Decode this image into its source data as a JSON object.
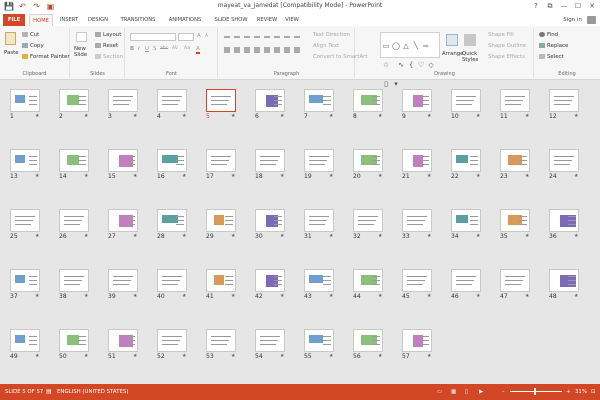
{
  "window": {
    "title": "mayeat_va_jamedat [Compatibility Mode] - PowerPoint",
    "controls": [
      "?",
      "⧉",
      "—",
      "☐",
      "✕"
    ]
  },
  "qat": [
    "💾",
    "↶",
    "↷",
    "▣"
  ],
  "tabs": [
    "FILE",
    "HOME",
    "INSERT",
    "DESIGN",
    "TRANSITIONS",
    "ANIMATIONS",
    "SLIDE SHOW",
    "REVIEW",
    "VIEW"
  ],
  "signin": "Sign in",
  "ribbon": {
    "clipboard": {
      "label": "Clipboard",
      "paste": "Paste",
      "cut": "Cut",
      "copy": "Copy",
      "format_painter": "Format Painter"
    },
    "slides": {
      "label": "Slides",
      "new_slide": "New Slide",
      "layout": "Layout",
      "reset": "Reset",
      "section": "Section"
    },
    "font": {
      "label": "Font",
      "buttons": [
        "B",
        "I",
        "U",
        "S",
        "abc",
        "AV",
        "Aa",
        "A"
      ]
    },
    "paragraph": {
      "label": "Paragraph",
      "text_direction": "Text Direction",
      "align_text": "Align Text",
      "convert_smartart": "Convert to SmartArt"
    },
    "drawing": {
      "label": "Drawing",
      "arrange": "Arrange",
      "quick_styles": "Quick Styles",
      "shape_fill": "Shape Fill",
      "shape_outline": "Shape Outline",
      "shape_effects": "Shape Effects"
    },
    "editing": {
      "label": "Editing",
      "find": "Find",
      "replace": "Replace",
      "select": "Select"
    }
  },
  "slides": {
    "selected": 5,
    "total": 57,
    "numbers": [
      "1",
      "2",
      "3",
      "4",
      "5",
      "6",
      "7",
      "8",
      "9",
      "10",
      "11",
      "12",
      "13",
      "14",
      "15",
      "16",
      "17",
      "18",
      "19",
      "20",
      "21",
      "22",
      "23",
      "24",
      "25",
      "26",
      "27",
      "28",
      "29",
      "30",
      "31",
      "32",
      "33",
      "34",
      "35",
      "36",
      "37",
      "38",
      "39",
      "40",
      "41",
      "42",
      "43",
      "44",
      "45",
      "46",
      "47",
      "48",
      "49",
      "50",
      "51",
      "52",
      "53",
      "54",
      "55",
      "56",
      "57"
    ],
    "star": "★"
  },
  "status": {
    "slide_info": "SLIDE 5 OF 57",
    "language": "ENGLISH (UNITED STATES)",
    "zoom_minus": "–",
    "zoom_plus": "+",
    "zoom": "31%"
  },
  "colors": {
    "accent": "#d24726",
    "status_bar": "#d24726",
    "ribbon_bg": "#f6f6f6",
    "canvas_bg": "#e6e6e6"
  }
}
